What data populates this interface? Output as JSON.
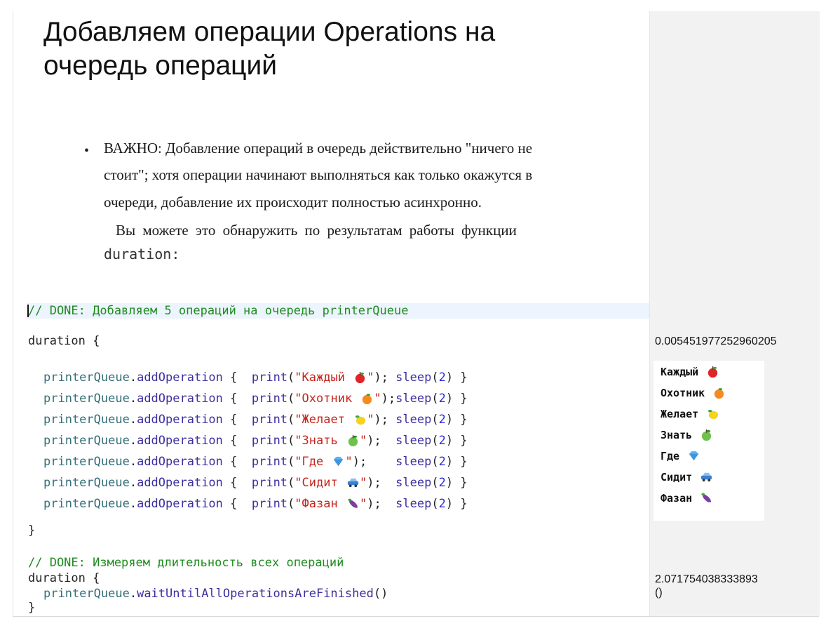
{
  "slide": {
    "title_line1": "Добавляем операции Operations на",
    "title_line2": "очередь операций",
    "bullet_line1": "ВАЖНО: Добавление операций в очередь действительно \"ничего не",
    "bullet_line2": "стоит\"; хотя операции начинают выполняться как только окажутся в",
    "bullet_line3": "очереди, добавление их происходит полностью асинхронно.",
    "bullet_line4": "Вы можете это обнаружить по результатам работы функции",
    "bullet_code": "duration",
    "bullet_colon": ":"
  },
  "code": {
    "comment1": "// DONE: Добавляем 5 операций на очередь printerQueue",
    "duration_open": "duration {",
    "receiver": "printerQueue",
    "dot": ".",
    "method": "addOperation",
    "brace_open": " {  ",
    "print_fn": "print",
    "sleep_fn": "sleep",
    "sleep_arg": "2",
    "lines": [
      {
        "str": "\"Каждый ",
        "str_end": "\"",
        "mid": "); ",
        "icon": "red-apple-icon"
      },
      {
        "str": "\"Охотник ",
        "str_end": "\"",
        "mid": ");",
        "icon": "tangerine-icon"
      },
      {
        "str": "\"Желает ",
        "str_end": "\"",
        "mid": "); ",
        "icon": "lemon-icon"
      },
      {
        "str": "\"Знать ",
        "str_end": "\"",
        "mid": ");  ",
        "icon": "green-apple-icon"
      },
      {
        "str": "\"Где ",
        "str_end": "\"",
        "mid": ");    ",
        "icon": "blue-diamond-icon"
      },
      {
        "str": "\"Сидит ",
        "str_end": "\"",
        "mid": ");  ",
        "icon": "car-icon"
      },
      {
        "str": "\"Фазан ",
        "str_end": "\"",
        "mid": ");  ",
        "icon": "eggplant-icon"
      }
    ],
    "close_brace": "}",
    "comment2": "// DONE: Измеряем длительность всех операций",
    "duration_open2": "duration {",
    "wait_method": "waitUntilAllOperationsAreFinished",
    "wait_parens": "()",
    "close_brace2": "}"
  },
  "results": {
    "first_duration": "0.005451977252960205",
    "console": [
      {
        "text": "Каждый",
        "icon": "red-apple-icon"
      },
      {
        "text": "Охотник",
        "icon": "tangerine-icon"
      },
      {
        "text": "Желает",
        "icon": "lemon-icon"
      },
      {
        "text": "Знать",
        "icon": "green-apple-icon"
      },
      {
        "text": "Где",
        "icon": "blue-diamond-icon"
      },
      {
        "text": "Сидит",
        "icon": "car-icon"
      },
      {
        "text": "Фазан",
        "icon": "eggplant-icon"
      }
    ],
    "second_duration": "2.071754038333893",
    "unit_result": "()"
  },
  "colors": {
    "comment": "#1f8c1f",
    "identifier": "#356f7a",
    "method": "#3c2fa0",
    "string": "#c4261d",
    "number": "#2b2bd6",
    "current_line": "#ecf4fd",
    "sidebar": "#f2f2f2"
  }
}
